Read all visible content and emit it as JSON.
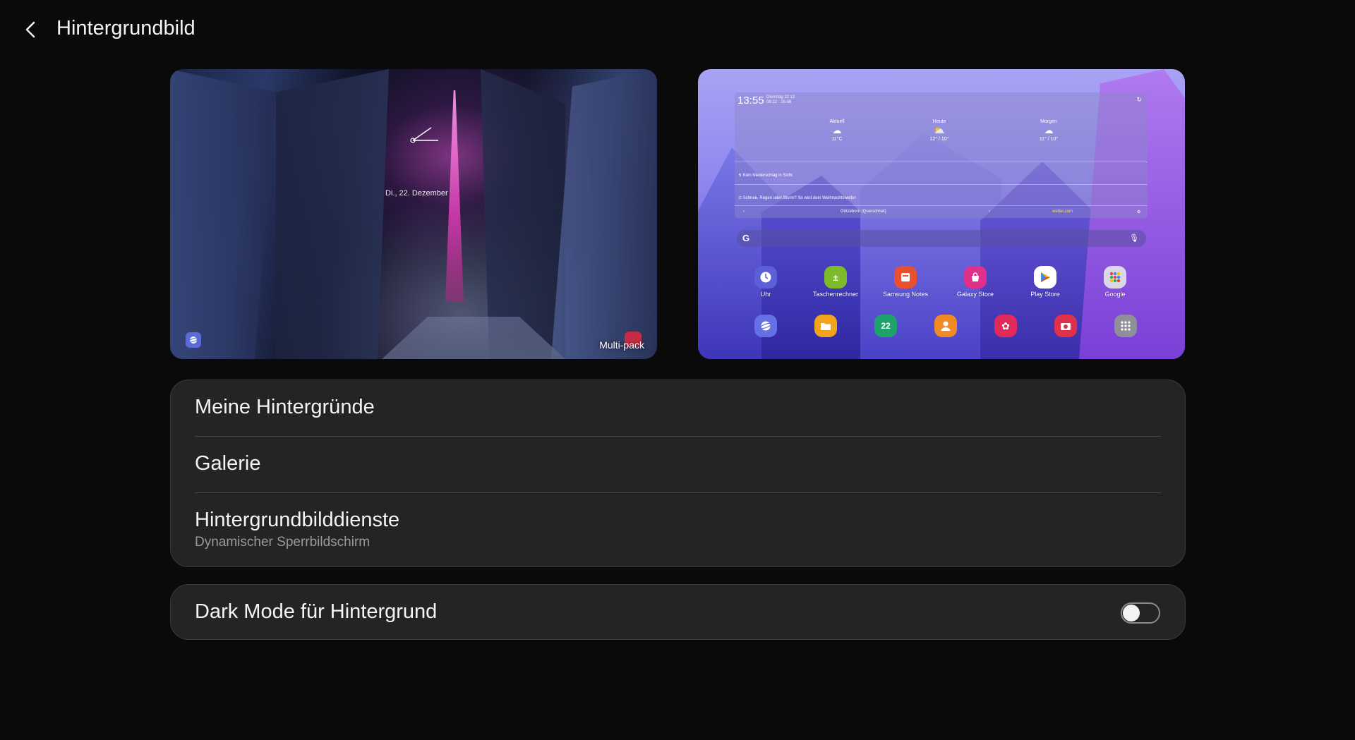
{
  "header": {
    "title": "Hintergrundbild"
  },
  "lock_preview": {
    "date": "Di., 22. Dezember",
    "tag": "Multi-pack"
  },
  "home_preview": {
    "widget": {
      "time": "13:55",
      "subline1": "Dienstag 22.12",
      "subline2": "08:22 · 16:06",
      "columns": [
        {
          "label": "Aktuell",
          "icon": "cloud-icon",
          "temp": "11°C"
        },
        {
          "label": "Heute",
          "icon": "partly-sunny-icon",
          "temp": "12° / 10°"
        },
        {
          "label": "Morgen",
          "icon": "cloud-icon",
          "temp": "11° / 10°"
        }
      ],
      "row1": "Kein Niederschlag in Sicht",
      "row2": "Schnee, Regen oder Sturm? So wird dein Weihnachtswetter",
      "location": "Götzeborn (Querschnet)",
      "brand": "wetter.com"
    },
    "apps": [
      {
        "name": "Uhr",
        "icon": "clock-icon",
        "color": "#5c5fd6"
      },
      {
        "name": "Taschenrechner",
        "icon": "calculator-icon",
        "color": "#7dbb2a"
      },
      {
        "name": "Samsung Notes",
        "icon": "notes-icon",
        "color": "#e8502f"
      },
      {
        "name": "Galaxy Store",
        "icon": "store-icon",
        "color": "#e0308c"
      },
      {
        "name": "Play Store",
        "icon": "play-icon",
        "color": "#ffffff"
      },
      {
        "name": "Google",
        "icon": "google-folder-icon",
        "color": "#d8d8e8"
      }
    ],
    "dock": [
      {
        "icon": "internet-icon",
        "color": "#6570e6"
      },
      {
        "icon": "folder-icon",
        "color": "#f3a21c"
      },
      {
        "icon": "calendar-icon",
        "color": "#1ea36a",
        "text": "22"
      },
      {
        "icon": "contacts-icon",
        "color": "#f08a24"
      },
      {
        "icon": "gallery-icon",
        "color": "#e22a5a"
      },
      {
        "icon": "camera-icon",
        "color": "#e0304c"
      },
      {
        "icon": "apps-grid-icon",
        "color": "#8f8f9a"
      }
    ]
  },
  "menu": {
    "items": [
      {
        "label": "Meine Hintergründe"
      },
      {
        "label": "Galerie"
      },
      {
        "label": "Hintergrundbilddienste",
        "sub": "Dynamischer Sperrbildschirm"
      }
    ]
  },
  "dark_mode": {
    "label": "Dark Mode für Hintergrund",
    "enabled": false
  }
}
